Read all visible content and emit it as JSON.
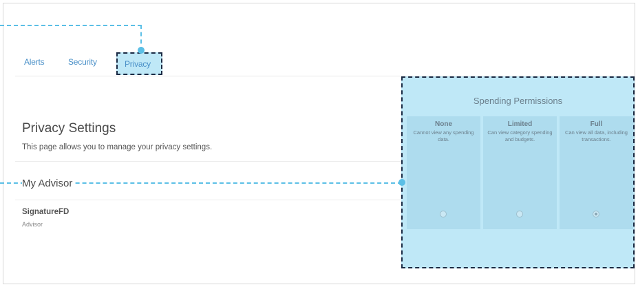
{
  "tabs": [
    {
      "label": "Alerts",
      "active": false
    },
    {
      "label": "Security",
      "active": false
    },
    {
      "label": "Privacy",
      "active": true
    }
  ],
  "page": {
    "title": "Privacy Settings",
    "description": "This page allows you to manage your privacy settings."
  },
  "advisor_section": {
    "title": "My Advisor",
    "advisor_name": "SignatureFD",
    "advisor_role": "Advisor"
  },
  "permissions": {
    "title": "Spending Permissions",
    "columns": [
      {
        "label": "None",
        "description": "Cannot view any spending data."
      },
      {
        "label": "Limited",
        "description": "Can view category spending and budgets."
      },
      {
        "label": "Full",
        "description": "Can view all data, including transactions."
      }
    ],
    "selected": "Full"
  },
  "colors": {
    "tab_link": "#4a90c8",
    "highlight_fill": "#bfe8f7",
    "highlight_border": "#1a2a44",
    "callout_line": "#5bbfe6"
  }
}
